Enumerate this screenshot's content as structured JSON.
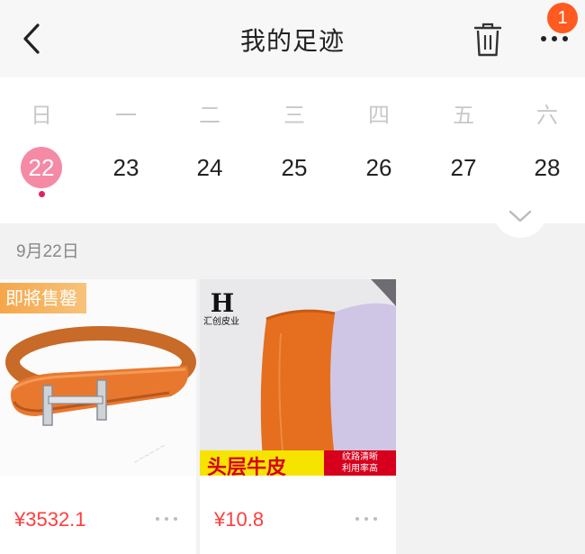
{
  "header": {
    "title": "我的足迹",
    "badge_count": "1"
  },
  "calendar": {
    "weekdays": [
      "日",
      "一",
      "二",
      "三",
      "四",
      "五",
      "六"
    ],
    "days": [
      "22",
      "23",
      "24",
      "25",
      "26",
      "27",
      "28"
    ],
    "selected_day": "22",
    "accent_color": "#f48aa5"
  },
  "section": {
    "date_label": "9月22日"
  },
  "products": [
    {
      "tag": "即將售罄",
      "price": "¥3532.1",
      "image_icon": "orange-leather-wrap-bracelet"
    },
    {
      "brand_name": "汇创皮业",
      "promo_main": "头层牛皮",
      "promo_sub_line1": "纹路清晰",
      "promo_sub_line2": "利用率高",
      "price": "¥10.8",
      "image_icon": "orange-and-lavender-leather-samples"
    }
  ]
}
